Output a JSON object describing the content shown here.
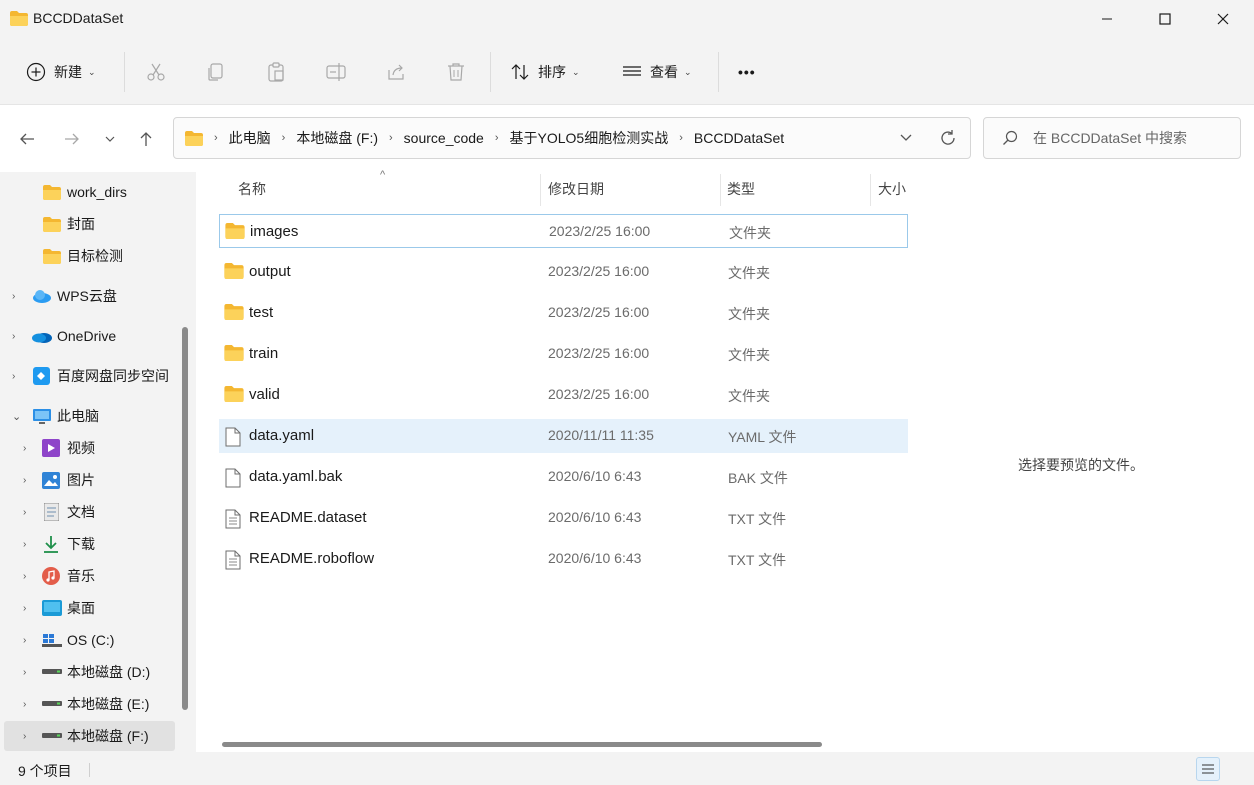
{
  "window": {
    "title": "BCCDDataSet",
    "minimize_icon": "minimize-icon",
    "maximize_icon": "maximize-icon",
    "close_icon": "close-icon"
  },
  "toolbar": {
    "new_label": "新建",
    "sort_label": "排序",
    "view_label": "查看",
    "more_label": "•••"
  },
  "address": {
    "crumbs": [
      "此电脑",
      "本地磁盘 (F:)",
      "source_code",
      "基于YOLO5细胞检测实战",
      "BCCDDataSet"
    ]
  },
  "search": {
    "placeholder": "在 BCCDDataSet 中搜索"
  },
  "sidebar": {
    "items": [
      {
        "label": "work_dirs",
        "icon": "folder-icon"
      },
      {
        "label": "封面",
        "icon": "folder-icon"
      },
      {
        "label": "目标检测",
        "icon": "folder-icon"
      },
      {
        "label": "WPS云盘",
        "icon": "cloud-icon"
      },
      {
        "label": "OneDrive",
        "icon": "onedrive-icon"
      },
      {
        "label": "百度网盘同步空间",
        "icon": "baidu-netdisk-icon"
      },
      {
        "label": "此电脑",
        "icon": "computer-icon"
      },
      {
        "label": "视频",
        "icon": "video-icon"
      },
      {
        "label": "图片",
        "icon": "pictures-icon"
      },
      {
        "label": "文档",
        "icon": "documents-icon"
      },
      {
        "label": "下载",
        "icon": "download-icon"
      },
      {
        "label": "音乐",
        "icon": "music-icon"
      },
      {
        "label": "桌面",
        "icon": "desktop-icon"
      },
      {
        "label": "OS (C:)",
        "icon": "windows-drive-icon"
      },
      {
        "label": "本地磁盘 (D:)",
        "icon": "drive-icon"
      },
      {
        "label": "本地磁盘 (E:)",
        "icon": "drive-icon"
      },
      {
        "label": "本地磁盘 (F:)",
        "icon": "drive-icon"
      }
    ]
  },
  "columns": {
    "name": "名称",
    "date": "修改日期",
    "type": "类型",
    "size": "大小"
  },
  "files": [
    {
      "name": "images",
      "date": "2023/2/25 16:00",
      "type": "文件夹",
      "icon": "folder-icon"
    },
    {
      "name": "output",
      "date": "2023/2/25 16:00",
      "type": "文件夹",
      "icon": "folder-icon"
    },
    {
      "name": "test",
      "date": "2023/2/25 16:00",
      "type": "文件夹",
      "icon": "folder-icon"
    },
    {
      "name": "train",
      "date": "2023/2/25 16:00",
      "type": "文件夹",
      "icon": "folder-icon"
    },
    {
      "name": "valid",
      "date": "2023/2/25 16:00",
      "type": "文件夹",
      "icon": "folder-icon"
    },
    {
      "name": "data.yaml",
      "date": "2020/11/11 11:35",
      "type": "YAML 文件",
      "icon": "file-icon"
    },
    {
      "name": "data.yaml.bak",
      "date": "2020/6/10 6:43",
      "type": "BAK 文件",
      "icon": "file-icon"
    },
    {
      "name": "README.dataset",
      "date": "2020/6/10 6:43",
      "type": "TXT 文件",
      "icon": "text-file-icon"
    },
    {
      "name": "README.roboflow",
      "date": "2020/6/10 6:43",
      "type": "TXT 文件",
      "icon": "text-file-icon"
    }
  ],
  "preview": {
    "message": "选择要预览的文件。"
  },
  "status": {
    "item_count": "9 个项目"
  },
  "colors": {
    "accent": "#0078d4",
    "folder": "#f8c42a",
    "selection": "#e5f1fb"
  }
}
